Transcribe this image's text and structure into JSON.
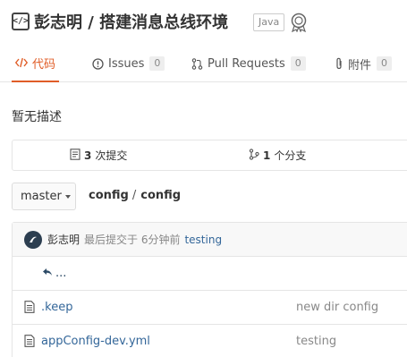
{
  "repo": {
    "icon_glyph": "</>",
    "title": "彭志明 / 搭建消息总线环境",
    "language": "Java"
  },
  "tabs": [
    {
      "label": "代码",
      "icon": "code-icon",
      "active": true
    },
    {
      "label": "Issues",
      "icon": "issue-icon",
      "count": "0"
    },
    {
      "label": "Pull Requests",
      "icon": "pull-request-icon",
      "count": "0"
    },
    {
      "label": "附件",
      "icon": "attachment-icon",
      "count": "0"
    }
  ],
  "description": "暂无描述",
  "stats": {
    "commits_count": "3",
    "commits_label": "次提交",
    "branches_count": "1",
    "branches_label": "个分支"
  },
  "branch": {
    "current": "master"
  },
  "breadcrumb": {
    "parent": "config",
    "separator": "/",
    "current": "config"
  },
  "last_commit": {
    "author": "彭志明",
    "meta": "最后提交于 6分钟前",
    "message": "testing"
  },
  "back_label": "...",
  "files": [
    {
      "name": ".keep",
      "message": "new dir config"
    },
    {
      "name": "appConfig-dev.yml",
      "message": "testing"
    }
  ],
  "colors": {
    "accent": "#e05d27",
    "link": "#336699"
  }
}
